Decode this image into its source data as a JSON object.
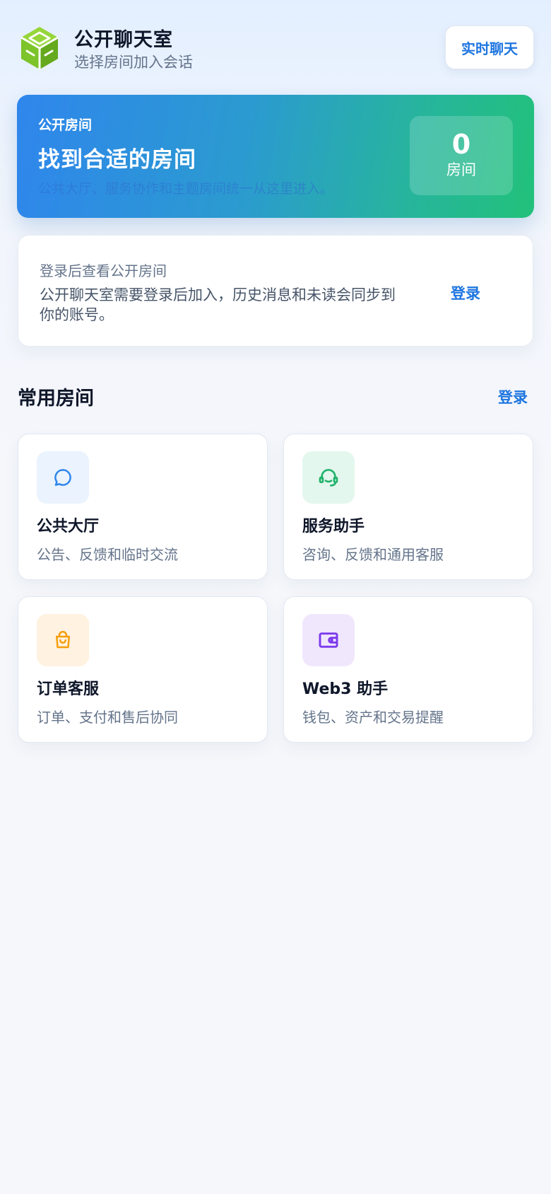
{
  "header": {
    "title": "公开聊天室",
    "subtitle": "选择房间加入会话",
    "chat_button": "实时聊天"
  },
  "hero": {
    "kicker": "公开房间",
    "title": "找到合适的房间",
    "description": "公共大厅、服务协作和主题房间统一从这里进入。",
    "room_count": "0",
    "room_unit": "房间"
  },
  "login_card": {
    "kicker": "登录后查看公开房间",
    "description": "公开聊天室需要登录后加入，历史消息和未读会同步到你的账号。",
    "login_label": "登录"
  },
  "section": {
    "title": "常用房间",
    "login_label": "登录"
  },
  "rooms": [
    {
      "title": "公共大厅",
      "description": "公告、反馈和临时交流",
      "icon": "chat-bubble-icon",
      "color": "#2f86ec",
      "bg": "#eaf3fe"
    },
    {
      "title": "服务助手",
      "description": "咨询、反馈和通用客服",
      "icon": "headset-icon",
      "color": "#22b36b",
      "bg": "#e3f7ee"
    },
    {
      "title": "订单客服",
      "description": "订单、支付和售后协同",
      "icon": "shopping-bag-icon",
      "color": "#f59e0b",
      "bg": "#fff2e0"
    },
    {
      "title": "Web3 助手",
      "description": "钱包、资产和交易提醒",
      "icon": "wallet-icon",
      "color": "#7c3aed",
      "bg": "#f1e7fd"
    }
  ],
  "colors": {
    "accent": "#1d75e0",
    "logo_green": "#7cc42a"
  }
}
